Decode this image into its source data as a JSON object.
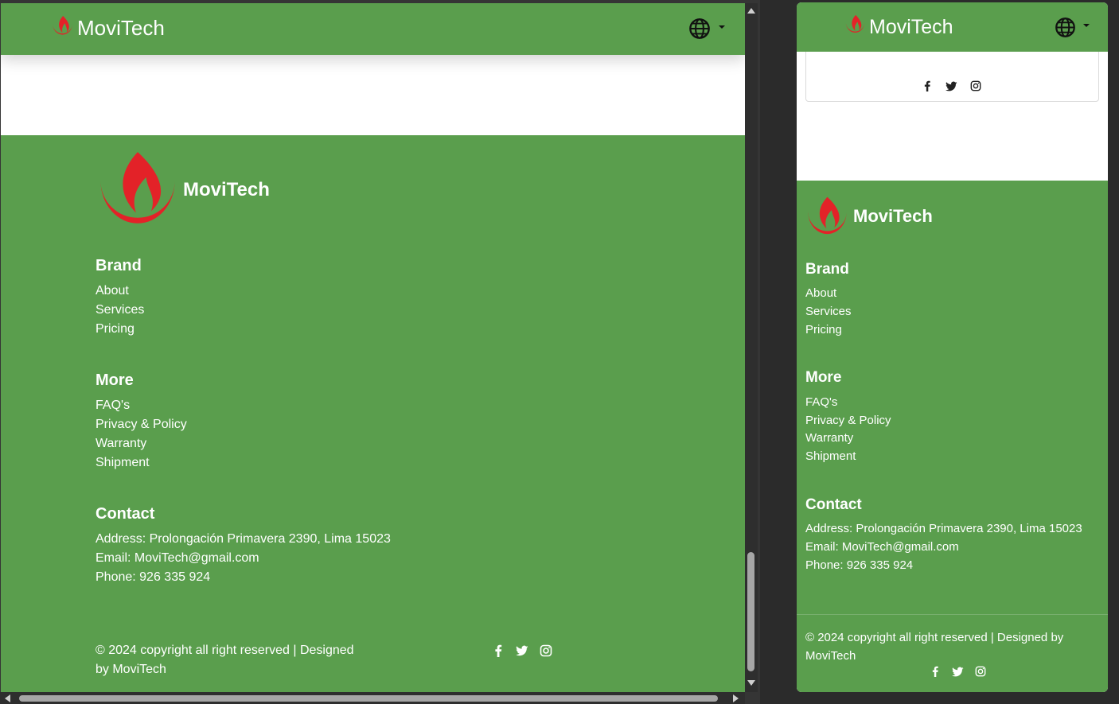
{
  "brand_name": "MoviTech",
  "colors": {
    "primary_green": "#5a9e4d",
    "logo_red": "#e32228",
    "white": "#ffffff"
  },
  "language_selector_icon": "globe-icon",
  "footer": {
    "brand": {
      "title": "Brand",
      "links": [
        "About",
        "Services",
        "Pricing"
      ]
    },
    "more": {
      "title": "More",
      "links": [
        "FAQ's",
        "Privacy & Policy",
        "Warranty",
        "Shipment"
      ]
    },
    "contact": {
      "title": "Contact",
      "address": "Address: Prolongación Primavera 2390, Lima 15023",
      "email": "Email: MoviTech@gmail.com",
      "phone": "Phone: 926 335 924"
    },
    "copyright_wide": [
      "© 2024 copyright all right reserved | Designed",
      "by MoviTech"
    ],
    "copyright_narrow": [
      "© 2024 copyright all right reserved | Designed by",
      "MoviTech"
    ],
    "social_icons": [
      "facebook-icon",
      "twitter-icon",
      "instagram-icon"
    ]
  }
}
